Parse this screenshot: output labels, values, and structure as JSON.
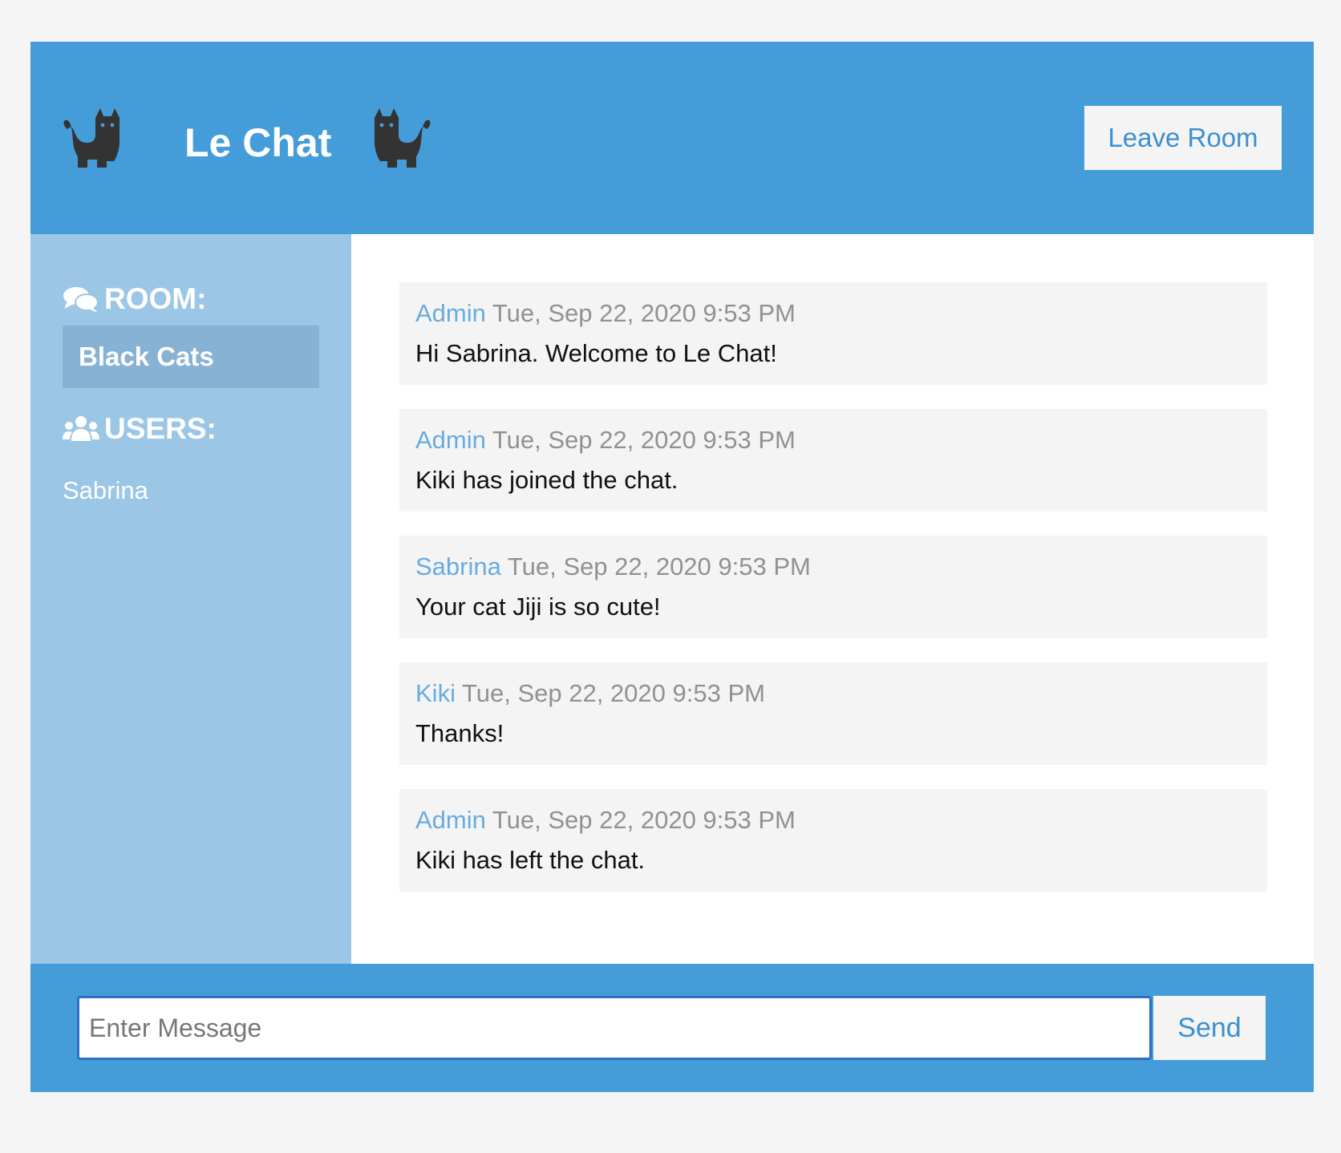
{
  "header": {
    "title": "Le Chat",
    "leave_label": "Leave Room",
    "left_icon": "cat-icon",
    "right_icon": "cat-icon"
  },
  "sidebar": {
    "room_heading": "ROOM:",
    "room_icon": "comments-icon",
    "room_name": "Black Cats",
    "users_heading": "USERS:",
    "users_icon": "users-icon",
    "users": [
      "Sabrina"
    ]
  },
  "messages": [
    {
      "author": "Admin",
      "time": "Tue, Sep 22, 2020 9:53 PM",
      "text": "Hi Sabrina. Welcome to Le Chat!"
    },
    {
      "author": "Admin",
      "time": "Tue, Sep 22, 2020 9:53 PM",
      "text": "Kiki has joined the chat."
    },
    {
      "author": "Sabrina",
      "time": "Tue, Sep 22, 2020 9:53 PM",
      "text": "Your cat Jiji is so cute!"
    },
    {
      "author": "Kiki",
      "time": "Tue, Sep 22, 2020 9:53 PM",
      "text": "Thanks!"
    },
    {
      "author": "Admin",
      "time": "Tue, Sep 22, 2020 9:53 PM",
      "text": "Kiki has left the chat."
    }
  ],
  "footer": {
    "input_placeholder": "Enter Message",
    "input_value": "",
    "send_label": "Send"
  },
  "colors": {
    "primary": "#449cd8",
    "sidebar": "#9bc6e6",
    "room_highlight": "#88b2d3",
    "message_bg": "#f4f4f4",
    "author": "#68ace0",
    "timestamp": "#919191",
    "button_text": "#3c8fd0"
  }
}
